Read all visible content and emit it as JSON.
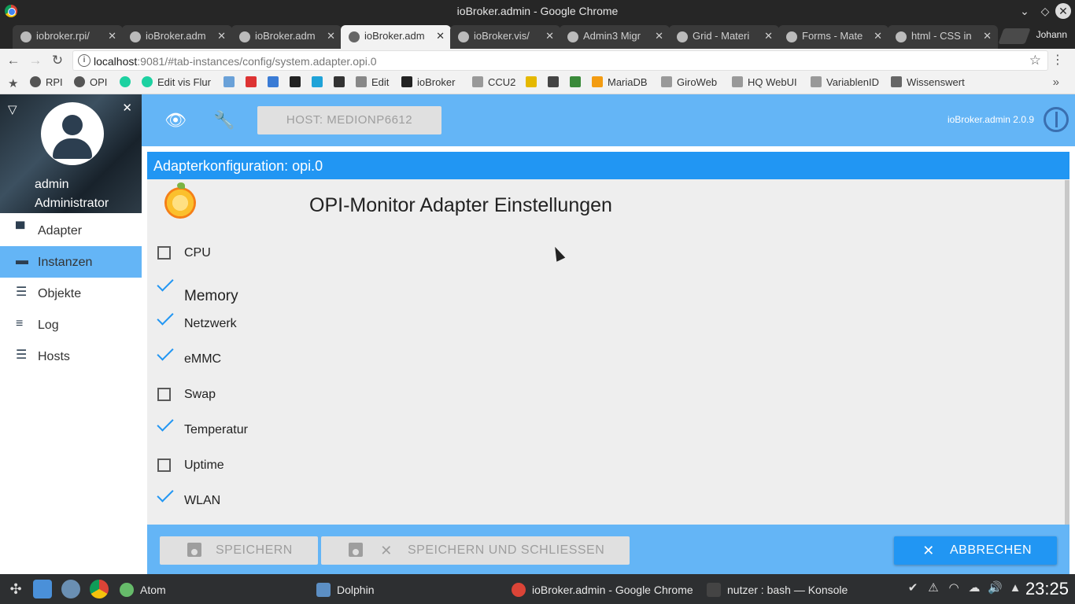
{
  "window": {
    "title": "ioBroker.admin - Google Chrome"
  },
  "tabs": [
    {
      "label": "iobroker.rpi/",
      "icon": "github-icon",
      "active": false
    },
    {
      "label": "ioBroker.adm",
      "icon": "github-icon",
      "active": false
    },
    {
      "label": "ioBroker.adm",
      "icon": "gear-icon",
      "active": false
    },
    {
      "label": "ioBroker.adm",
      "icon": "gear-icon",
      "active": true
    },
    {
      "label": "ioBroker.vis/",
      "icon": "github-icon",
      "active": false
    },
    {
      "label": "Admin3 Migr",
      "icon": "io-icon",
      "active": false
    },
    {
      "label": "Grid - Materi",
      "icon": "materialize-icon",
      "active": false
    },
    {
      "label": "Forms - Mate",
      "icon": "materialize-icon",
      "active": false
    },
    {
      "label": "html - CSS in",
      "icon": "stackoverflow-icon",
      "active": false
    }
  ],
  "profile": "Johann",
  "address": {
    "host": "localhost",
    "rest": ":9081/#tab-instances/config/system.adapter.opi.0"
  },
  "bookmarks": [
    {
      "label": "",
      "icon": "star-icon"
    },
    {
      "label": "RPI",
      "icon": "gear-icon"
    },
    {
      "label": "OPI",
      "icon": "gear-icon"
    },
    {
      "label": "",
      "icon": "green-dot-icon"
    },
    {
      "label": "Edit vis Flur",
      "icon": "green-dot-icon"
    },
    {
      "label": "",
      "icon": "gauge-icon"
    },
    {
      "label": "",
      "icon": "fritz-icon"
    },
    {
      "label": "",
      "icon": "dsm-icon"
    },
    {
      "label": "",
      "icon": "plex-icon"
    },
    {
      "label": "",
      "icon": "io-icon"
    },
    {
      "label": "",
      "icon": "plus-icon"
    },
    {
      "label": "Edit",
      "icon": "flot-icon"
    },
    {
      "label": "ioBroker",
      "icon": "github-icon"
    },
    {
      "label": "CCU2",
      "icon": "page-icon"
    },
    {
      "label": "",
      "icon": "imdb-icon"
    },
    {
      "label": "",
      "icon": "book-icon"
    },
    {
      "label": "",
      "icon": "bug-icon"
    },
    {
      "label": "MariaDB",
      "icon": "pma-icon"
    },
    {
      "label": "GiroWeb",
      "icon": "page-icon"
    },
    {
      "label": "HQ WebUI",
      "icon": "page-icon"
    },
    {
      "label": "VariablenID",
      "icon": "page-icon"
    },
    {
      "label": "Wissenswert",
      "icon": "folder-icon"
    }
  ],
  "header": {
    "host_button": "HOST: MEDIONP6612",
    "version": "ioBroker.admin 2.0.9"
  },
  "user": {
    "name": "admin",
    "role": "Administrator"
  },
  "nav": [
    {
      "label": "Adapter",
      "icon": "store-icon",
      "active": false
    },
    {
      "label": "Instanzen",
      "icon": "instances-icon",
      "active": true
    },
    {
      "label": "Objekte",
      "icon": "list-icon",
      "active": false
    },
    {
      "label": "Log",
      "icon": "log-icon",
      "active": false
    },
    {
      "label": "Hosts",
      "icon": "hosts-icon",
      "active": false
    }
  ],
  "config": {
    "header": "Adapterkonfiguration: opi.0",
    "title": "OPI-Monitor Adapter Einstellungen",
    "options": [
      {
        "label": "CPU",
        "checked": false
      },
      {
        "label": "Memory",
        "checked": true
      },
      {
        "label": "Netzwerk",
        "checked": true
      },
      {
        "label": "eMMC",
        "checked": true
      },
      {
        "label": "Swap",
        "checked": false
      },
      {
        "label": "Temperatur",
        "checked": true
      },
      {
        "label": "Uptime",
        "checked": false
      },
      {
        "label": "WLAN",
        "checked": true
      }
    ]
  },
  "actions": {
    "save": "SPEICHERN",
    "save_close": "SPEICHERN UND SCHLIESSEN",
    "cancel": "ABBRECHEN"
  },
  "taskbar": {
    "tasks": [
      {
        "label": "Atom",
        "icon": "atom-icon"
      },
      {
        "label": "Dolphin",
        "icon": "dolphin-icon"
      },
      {
        "label": "ioBroker.admin - Google Chrome",
        "icon": "chrome-icon"
      },
      {
        "label": "nutzer : bash — Konsole",
        "icon": "terminal-icon"
      }
    ],
    "clock": "23:25"
  }
}
